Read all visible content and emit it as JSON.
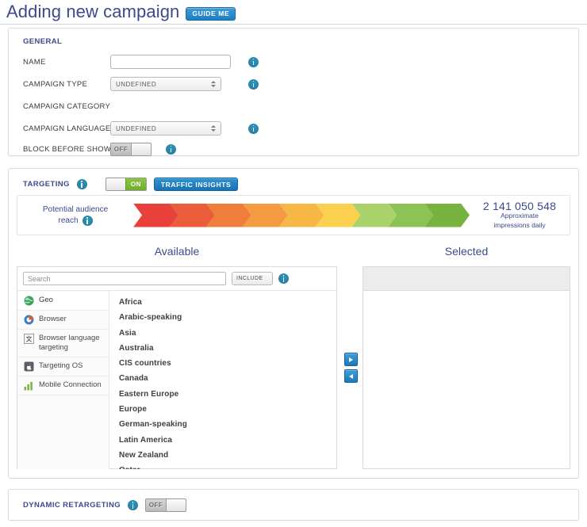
{
  "header": {
    "title": "Adding new campaign",
    "guide_me_label": "GUIDE ME"
  },
  "general": {
    "section_title": "GENERAL",
    "fields": [
      {
        "label": "NAME",
        "type": "text",
        "value": "",
        "placeholder": ""
      },
      {
        "label": "CAMPAIGN TYPE",
        "type": "select",
        "value": "UNDEFINED"
      },
      {
        "label": "CAMPAIGN CATEGORY",
        "type": "none",
        "value": ""
      },
      {
        "label": "CAMPAIGN LANGUAGE",
        "type": "select",
        "value": "UNDEFINED"
      },
      {
        "label": "BLOCK BEFORE SHOW",
        "type": "toggle",
        "value": "OFF"
      }
    ]
  },
  "targeting": {
    "section_title": "TARGETING",
    "toggle_state": "ON",
    "traffic_insights_label": "TRAFFIC INSIGHTS",
    "reach": {
      "label_line1": "Potential audience",
      "label_line2": "reach",
      "value": "2 141 050 548",
      "sub_line1": "Approximate",
      "sub_line2": "impressions daily",
      "segment_colors": [
        "#e8413c",
        "#ea5c3a",
        "#ef7d3c",
        "#f39a42",
        "#f6b745",
        "#fbd04e",
        "#a9d36a",
        "#8cc256",
        "#77b33e"
      ]
    },
    "available": {
      "heading": "Available",
      "search_placeholder": "Search",
      "search_value": "",
      "include_label": "INCLUDE",
      "categories": [
        {
          "label": "Geo",
          "icon": "globe-icon",
          "active": true
        },
        {
          "label": "Browser",
          "icon": "browser-icon",
          "active": false
        },
        {
          "label": "Browser language targeting",
          "icon": "language-icon",
          "active": false
        },
        {
          "label": "Targeting OS",
          "icon": "os-icon",
          "active": false
        },
        {
          "label": "Mobile Connection",
          "icon": "signal-bars-icon",
          "active": false
        }
      ],
      "options": [
        "Africa",
        "Arabic-speaking",
        "Asia",
        "Australia",
        "CIS countries",
        "Canada",
        "Eastern Europe",
        "Europe",
        "German-speaking",
        "Latin America",
        "New Zealand",
        "Qatar"
      ]
    },
    "selected": {
      "heading": "Selected",
      "items": []
    },
    "move_right_label": "",
    "move_left_label": ""
  },
  "dynamic_retargeting": {
    "section_title": "DYNAMIC RETARGETING",
    "toggle_state": "OFF"
  },
  "colors": {
    "accent_blue": "#1873b4",
    "title_blue": "#3b4a8c",
    "info_teal": "#2d8fb5",
    "toggle_green": "#8cc63e"
  }
}
